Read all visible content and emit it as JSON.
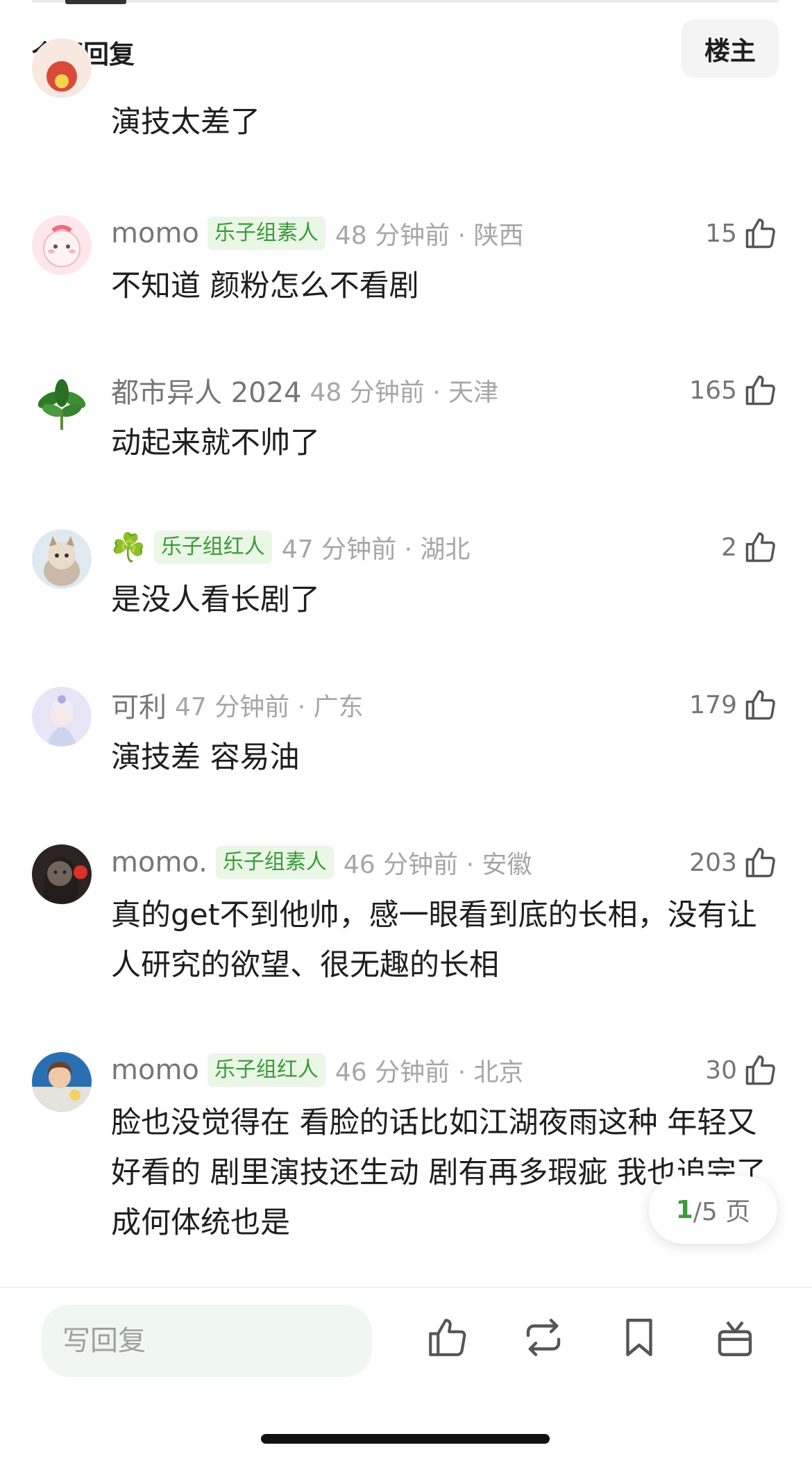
{
  "header": {
    "title": "全部回复",
    "host_button": "楼主"
  },
  "comments": [
    {
      "username": "",
      "badge": "",
      "time": "",
      "likes": "",
      "content": "演技太差了"
    },
    {
      "username": "momo",
      "badge": "乐子组素人",
      "time": "48 分钟前 · 陕西",
      "likes": "15",
      "content": "不知道 颜粉怎么不看剧"
    },
    {
      "username": "都市异人 2024",
      "badge": "",
      "time": "48 分钟前 · 天津",
      "likes": "165",
      "content": "动起来就不帅了"
    },
    {
      "username": "☘️",
      "badge": "乐子组红人",
      "time": "47 分钟前 · 湖北",
      "likes": "2",
      "content": "是没人看长剧了"
    },
    {
      "username": "可利",
      "badge": "",
      "time": "47 分钟前 · 广东",
      "likes": "179",
      "content": "演技差 容易油"
    },
    {
      "username": "momo.",
      "badge": "乐子组素人",
      "time": "46 分钟前 · 安徽",
      "likes": "203",
      "content": "真的get不到他帅，感一眼看到底的长相，没有让人研究的欲望、很无趣的长相"
    },
    {
      "username": "momo",
      "badge": "乐子组红人",
      "time": "46 分钟前 · 北京",
      "likes": "30",
      "content": "脸也没觉得在 看脸的话比如江湖夜雨这种 年轻又好看的 剧里演技还生动 剧有再多瑕疵 我也追完了 成何体统也是"
    }
  ],
  "pager": {
    "current": "1",
    "total": "/5 页"
  },
  "bottom_bar": {
    "reply_placeholder": "写回复"
  },
  "colors": {
    "accent_green": "#3b9a3b",
    "badge_bg": "#eaf6e6"
  }
}
